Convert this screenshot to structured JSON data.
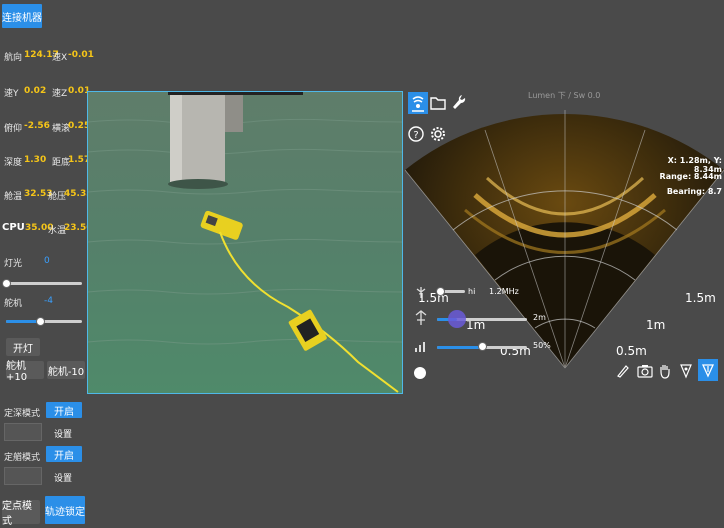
{
  "left_panel": {
    "connect_button": "连接机器",
    "telemetry": [
      {
        "label": "航向",
        "value": "124.17",
        "label2": "速X",
        "value2": "-0.01"
      },
      {
        "label": "速Y",
        "value": "0.02",
        "label2": "速Z",
        "value2": "0.01"
      },
      {
        "label": "俯仰",
        "value": "-2.56",
        "label2": "横滚",
        "value2": "0.25"
      },
      {
        "label": "深度",
        "value": "1.30",
        "label2": "距底",
        "value2": "1.57"
      },
      {
        "label": "舱温",
        "value": "32.53",
        "label2": "舱压",
        "value2": "45.33"
      }
    ],
    "cpu_row": {
      "label": "CPU",
      "value": "35.00",
      "label2": "水温",
      "value2": "23.50"
    },
    "light": {
      "label": "灯光",
      "value": "0",
      "level": 0
    },
    "pan": {
      "label": "舵机",
      "value": "-4",
      "level": 0.45
    },
    "open_light_button": "开灯",
    "pan_plus_button": "舵机+10",
    "pan_minus_button": "舵机-10",
    "depth_hold": {
      "label": "定深模式",
      "toggle": "开启",
      "set_button": "设置"
    },
    "heading_hold": {
      "label": "定艏模式",
      "toggle": "开启",
      "set_button": "设置"
    },
    "auto_mode_label": "定点模式",
    "lock_button": "轨迹锁定"
  },
  "sonar": {
    "top_label": "Lumen 下 / Sw 0.0",
    "readout": {
      "xy": "X: 1.28m, Y: 8.34m",
      "range": "Range: 8.44m",
      "bearing": "Bearing: 8.7"
    },
    "range_labels": {
      "r1_left": "1.5m",
      "r1_right": "1.5m",
      "r2_left": "1m",
      "r2_right": "1m",
      "r3_left": "0.5m",
      "r3_right": "0.5m"
    },
    "controls": {
      "freq": {
        "left": "hi",
        "right": "1.2MHz",
        "level": 0.12
      },
      "range": {
        "value": "2m",
        "level": 0.22
      },
      "gain": {
        "value": "50%",
        "level": 0.5
      }
    }
  },
  "colors": {
    "accent": "#2b8fe8",
    "value": "#f5c518",
    "video_border": "#4fb8e8"
  }
}
